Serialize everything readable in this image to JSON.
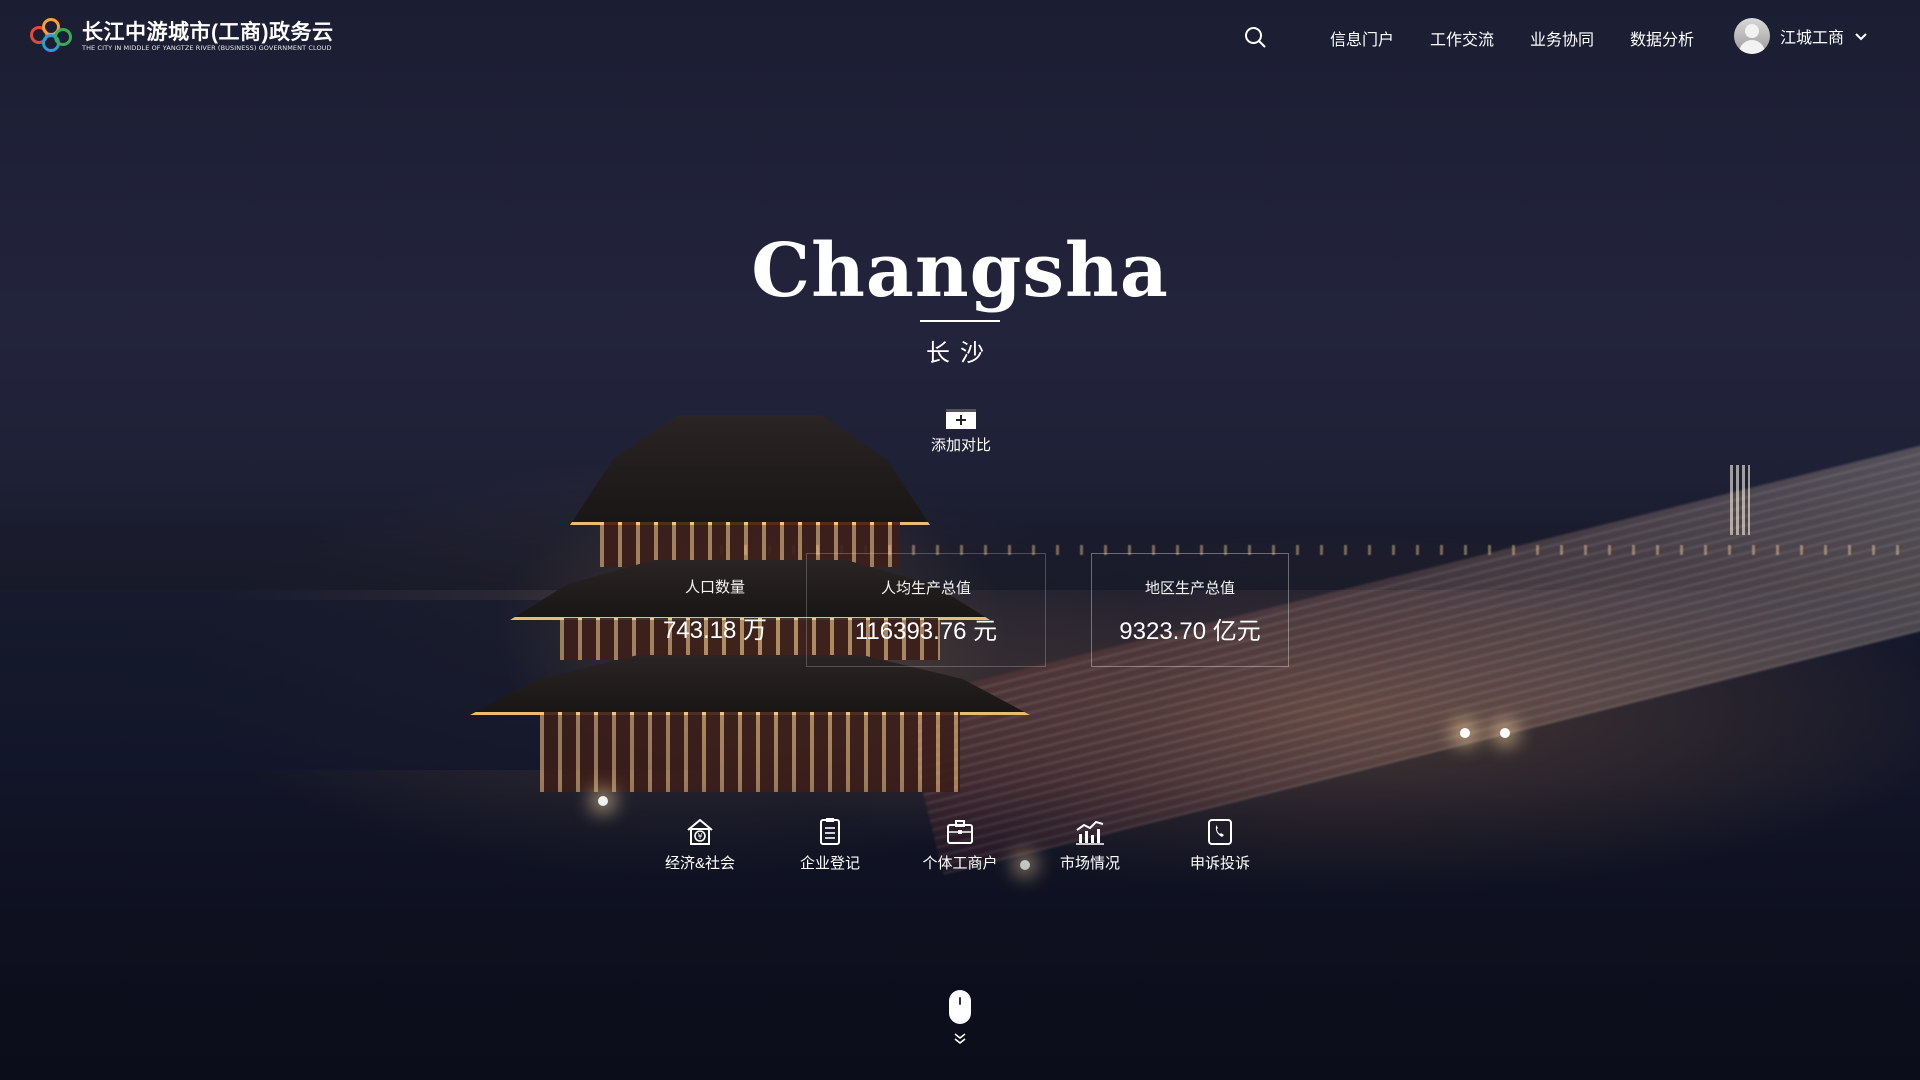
{
  "header": {
    "logo_title": "长江中游城市(工商)政务云",
    "logo_subtitle": "THE CITY IN MIDDLE OF YANGTZE RIVER (BUSINESS) GOVERNMENT CLOUD",
    "nav": [
      "信息门户",
      "工作交流",
      "业务协同",
      "数据分析"
    ],
    "user_name": "江城工商"
  },
  "hero": {
    "title": "Changsha",
    "subtitle": "长沙",
    "compare_label": "添加对比"
  },
  "stats": [
    {
      "label": "人口数量",
      "value": "743.18 万"
    },
    {
      "label": "人均生产总值",
      "value": "116393.76 元"
    },
    {
      "label": "地区生产总值",
      "value": "9323.70 亿元"
    }
  ],
  "categories": [
    {
      "label": "经济&社会",
      "icon": "economy-society-icon"
    },
    {
      "label": "企业登记",
      "icon": "enterprise-registration-icon"
    },
    {
      "label": "个体工商户",
      "icon": "individual-business-icon"
    },
    {
      "label": "市场情况",
      "icon": "market-chart-icon"
    },
    {
      "label": "申诉投诉",
      "icon": "complaint-phone-icon"
    }
  ]
}
